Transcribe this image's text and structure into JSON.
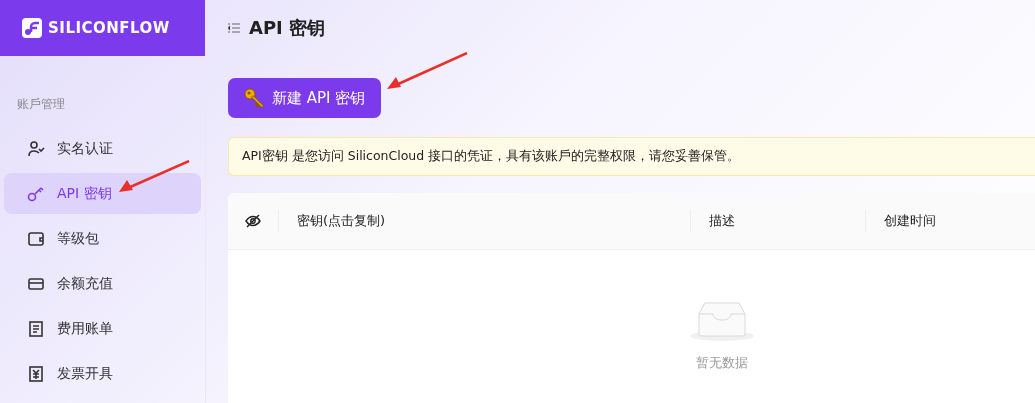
{
  "brand": {
    "name": "SILICONFLOW"
  },
  "sidebar": {
    "section": "账戶管理",
    "items": [
      {
        "label": "实名认证",
        "selected": false
      },
      {
        "label": "API 密钥",
        "selected": true
      },
      {
        "label": "等级包",
        "selected": false
      },
      {
        "label": "余额充值",
        "selected": false
      },
      {
        "label": "费用账单",
        "selected": false
      },
      {
        "label": "发票开具",
        "selected": false
      }
    ]
  },
  "page": {
    "title": "API 密钥",
    "new_button": "新建 API 密钥",
    "notice": "API密钥 是您访问 SiliconCloud 接口的凭证，具有该账戶的完整权限，请您妥善保管。"
  },
  "table": {
    "columns": [
      "密钥(点击复制)",
      "描述",
      "创建时间"
    ],
    "empty_text": "暂无数据"
  }
}
